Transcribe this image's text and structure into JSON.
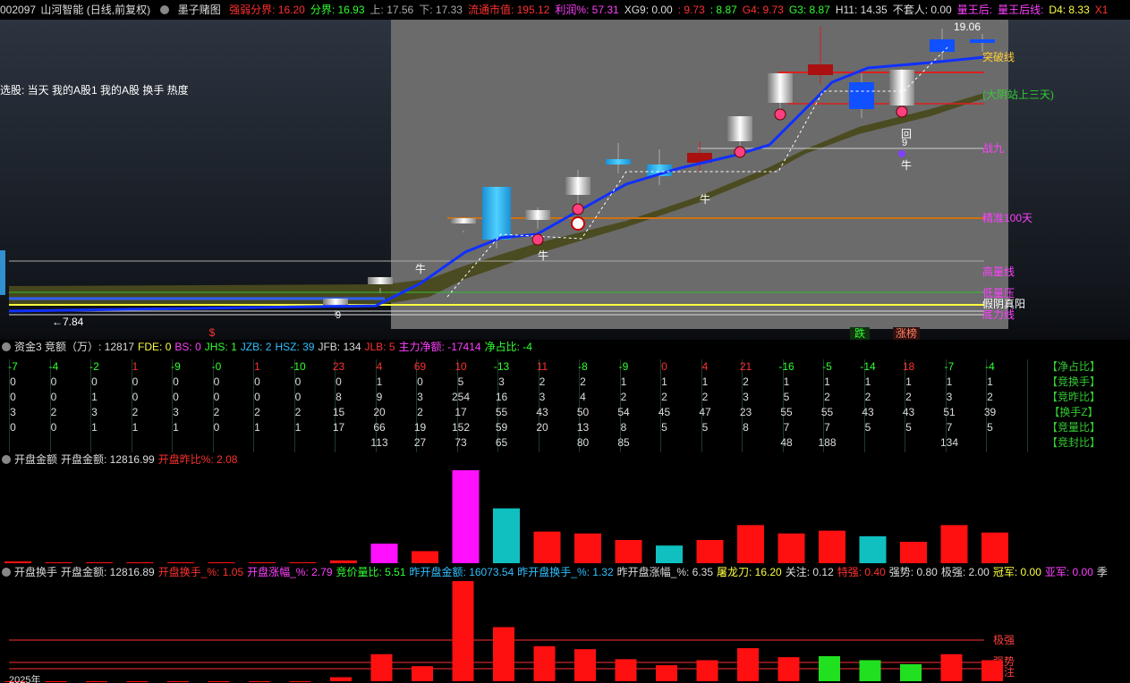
{
  "topbar": {
    "code": "002097",
    "name": "山河智能",
    "mode": "(日线,前复权)",
    "formula": "墨子赌图",
    "items": [
      {
        "label": "强弱分界:",
        "value": "16.20",
        "color": "#ff3030"
      },
      {
        "label": "分界:",
        "value": "16.93",
        "color": "#30ff30"
      },
      {
        "label": "上:",
        "value": "17.56",
        "color": "#aaaaaa"
      },
      {
        "label": "下:",
        "value": "17.33",
        "color": "#aaaaaa"
      },
      {
        "label": "流通市值:",
        "value": "195.12",
        "color": "#ff3030"
      },
      {
        "label": "利润%:",
        "value": "57.31",
        "color": "#ff40ff"
      },
      {
        "label": "XG9:",
        "value": "0.00",
        "color": "#dddddd"
      },
      {
        "label": ":",
        "value": "9.73",
        "color": "#ff3030"
      },
      {
        "label": ":",
        "value": "8.87",
        "color": "#30ff30"
      },
      {
        "label": "G4:",
        "value": "9.73",
        "color": "#ff3030"
      },
      {
        "label": "G3:",
        "value": "8.87",
        "color": "#30ff30"
      },
      {
        "label": "H11:",
        "value": "14.35",
        "color": "#dddddd"
      },
      {
        "label": "不套人:",
        "value": "0.00",
        "color": "#dddddd"
      },
      {
        "label": "量王后:",
        "value": "",
        "color": "#ff40ff"
      },
      {
        "label": "量王后线:",
        "value": "",
        "color": "#ff40ff"
      },
      {
        "label": "D4:",
        "value": "8.33",
        "color": "#ffff40"
      },
      {
        "label": "X1",
        "value": "",
        "color": "#ff3030"
      }
    ]
  },
  "main": {
    "stock_pick": "选股: 当天 我的A股1 我的A股 换手 热度",
    "price_high": "19.06",
    "price_low": "←7.84",
    "labels": [
      {
        "text": "突破线",
        "color": "#ffcc33"
      },
      {
        "text": "(大阴站上三天)",
        "color": "#33cc33"
      },
      {
        "text": "战九",
        "color": "#ff40ff"
      },
      {
        "text": "精准100天",
        "color": "#ff40ff"
      },
      {
        "text": "高量线",
        "color": "#ff40ff"
      },
      {
        "text": "低量压",
        "color": "#ff40ff"
      },
      {
        "text": "假阴真阳",
        "color": "#ffffff"
      },
      {
        "text": "底力线",
        "color": "#ff40ff"
      }
    ],
    "markers": {
      "cow": "牛",
      "back": "回",
      "nine": "9",
      "dollar": "$",
      "fall": "跌",
      "limitup": "涨榜"
    }
  },
  "panel2": {
    "title": "资金3 竞额（万）: 12817",
    "items": [
      {
        "label": "FDE:",
        "value": "0",
        "color": "#ffff40"
      },
      {
        "label": "BS:",
        "value": "0",
        "color": "#ff40ff"
      },
      {
        "label": "JHS:",
        "value": "1",
        "color": "#30ff30"
      },
      {
        "label": "JZB:",
        "value": "2",
        "color": "#30c0ff"
      },
      {
        "label": "HSZ:",
        "value": "39",
        "color": "#30c0ff"
      },
      {
        "label": "JFB:",
        "value": "134",
        "color": "#dddddd"
      },
      {
        "label": "JLB:",
        "value": "5",
        "color": "#ff3030"
      },
      {
        "label": "主力净额:",
        "value": "-17414",
        "color": "#ff40ff"
      },
      {
        "label": "净占比:",
        "value": "-4",
        "color": "#30ff30"
      }
    ],
    "rows": [
      [
        "-7",
        "-4",
        "-2",
        "1",
        "-9",
        "-0",
        "1",
        "-10",
        "23",
        "4",
        "69",
        "10",
        "-13",
        "11",
        "-8",
        "-9",
        "0",
        "4",
        "21",
        "-16",
        "-5",
        "-14",
        "18",
        "-7",
        "-4"
      ],
      [
        "0",
        "0",
        "0",
        "0",
        "0",
        "0",
        "0",
        "0",
        "0",
        "1",
        "0",
        "5",
        "3",
        "2",
        "2",
        "1",
        "1",
        "1",
        "2",
        "1",
        "1",
        "1",
        "1",
        "1",
        "1"
      ],
      [
        "0",
        "0",
        "1",
        "0",
        "0",
        "0",
        "0",
        "0",
        "8",
        "9",
        "3",
        "254",
        "16",
        "3",
        "4",
        "2",
        "2",
        "2",
        "3",
        "5",
        "2",
        "2",
        "2",
        "3",
        "2"
      ],
      [
        "3",
        "2",
        "3",
        "2",
        "3",
        "2",
        "2",
        "2",
        "15",
        "20",
        "2",
        "17",
        "55",
        "43",
        "50",
        "54",
        "45",
        "47",
        "23",
        "55",
        "55",
        "43",
        "43",
        "51",
        "39"
      ],
      [
        "0",
        "0",
        "1",
        "1",
        "1",
        "0",
        "1",
        "1",
        "17",
        "66",
        "19",
        "152",
        "59",
        "20",
        "13",
        "8",
        "5",
        "5",
        "8",
        "7",
        "7",
        "5",
        "5",
        "7",
        "5"
      ],
      [
        "",
        "",
        "",
        "",
        "",
        "",
        "",
        "",
        "",
        "113",
        "27",
        "73",
        "65",
        "",
        "80",
        "85",
        "",
        "",
        "",
        "48",
        "188",
        "",
        "",
        "134",
        ""
      ]
    ],
    "right_labels": [
      "【净占比】",
      "【竞换手】",
      "【竞昨比】",
      "【换手Z】",
      "【竞量比】",
      "【竞封比】"
    ]
  },
  "panel3": {
    "title": "开盘金额",
    "items": [
      {
        "label": "开盘金额:",
        "value": "12816.99",
        "color": "#dddddd"
      },
      {
        "label": "开盘昨比%:",
        "value": "2.08",
        "color": "#ff3030"
      }
    ],
    "bars": [
      2,
      1,
      1,
      1,
      1,
      1,
      1,
      1,
      3,
      21,
      13,
      100,
      59,
      34,
      32,
      25,
      19,
      25,
      41,
      32,
      35,
      29,
      23,
      41,
      33
    ]
  },
  "panel4": {
    "title": "开盘换手",
    "items": [
      {
        "label": "开盘金额:",
        "value": "12816.89",
        "color": "#dddddd"
      },
      {
        "label": "开盘换手_%:",
        "value": "1.05",
        "color": "#ff3030"
      },
      {
        "label": "开盘涨幅_%:",
        "value": "2.79",
        "color": "#ff40ff"
      },
      {
        "label": "竞价量比:",
        "value": "5.51",
        "color": "#30ff30"
      },
      {
        "label": "昨开盘金额:",
        "value": "16073.54",
        "color": "#30c0ff"
      },
      {
        "label": "昨开盘换手_%:",
        "value": "1.32",
        "color": "#30c0ff"
      },
      {
        "label": "昨开盘涨幅_%:",
        "value": "6.35",
        "color": "#dddddd"
      },
      {
        "label": "屠龙刀:",
        "value": "16.20",
        "color": "#ffff40"
      },
      {
        "label": "关注:",
        "value": "0.12",
        "color": "#dddddd"
      },
      {
        "label": "特强:",
        "value": "0.40",
        "color": "#ff3030"
      },
      {
        "label": "强势:",
        "value": "0.80",
        "color": "#dddddd"
      },
      {
        "label": "极强:",
        "value": "2.00",
        "color": "#dddddd"
      },
      {
        "label": "冠军:",
        "value": "0.00",
        "color": "#ffff40"
      },
      {
        "label": "亚军:",
        "value": "0.00",
        "color": "#ff40ff"
      },
      {
        "label": "季",
        "value": "",
        "color": "#dddddd"
      }
    ],
    "levels": [
      "极强",
      "强势",
      "关注"
    ],
    "bars": [
      0,
      0,
      0,
      0,
      0,
      0,
      0,
      0,
      4,
      27,
      15,
      100,
      54,
      35,
      32,
      22,
      16,
      21,
      33,
      24,
      25,
      21,
      17,
      27,
      21
    ],
    "bar_colors": [
      "r",
      "r",
      "r",
      "r",
      "r",
      "r",
      "r",
      "r",
      "r",
      "r",
      "r",
      "r",
      "r",
      "r",
      "r",
      "r",
      "r",
      "r",
      "r",
      "r",
      "g",
      "g",
      "g",
      "r",
      "r"
    ],
    "bottom_label": "2025年"
  }
}
